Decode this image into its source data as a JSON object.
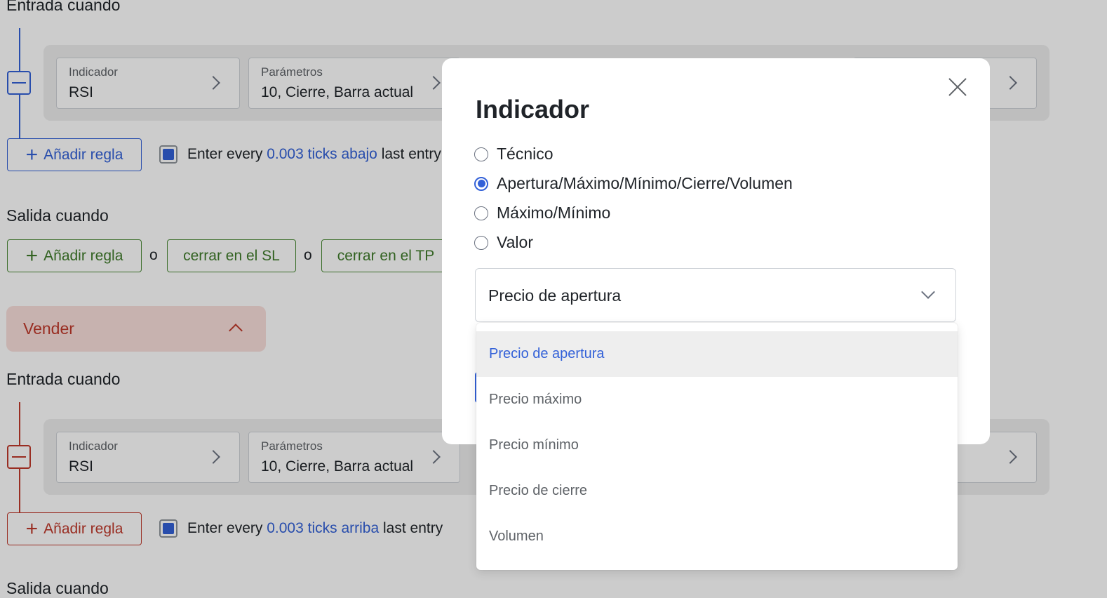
{
  "buy_section": {
    "entry_title": "Entrada cuando",
    "cards": [
      {
        "label": "Indicador",
        "value": "RSI"
      },
      {
        "label": "Parámetros",
        "value": "10, Cierre, Barra actual"
      }
    ],
    "add_rule_label": "Añadir regla",
    "enter": {
      "prefix": "Enter every",
      "link": "0.003 ticks abajo",
      "suffix": "last entry"
    },
    "exit_title": "Salida cuando",
    "exit_add_rule_label": "Añadir regla",
    "or_label": "o",
    "exit_chips": [
      "cerrar en el SL",
      "cerrar en el TP"
    ]
  },
  "sell_panel": {
    "label": "Vender"
  },
  "sell_section": {
    "entry_title": "Entrada cuando",
    "cards": [
      {
        "label": "Indicador",
        "value": "RSI"
      },
      {
        "label": "Parámetros",
        "value": "10, Cierre, Barra actual"
      }
    ],
    "add_rule_label": "Añadir regla",
    "enter": {
      "prefix": "Enter every",
      "link": "0.003 ticks arriba",
      "suffix": "last entry"
    },
    "exit_title": "Salida cuando"
  },
  "modal": {
    "title": "Indicador",
    "radio_options": [
      "Técnico",
      "Apertura/Máximo/Mínimo/Cierre/Volumen",
      "Máximo/Mínimo",
      "Valor"
    ],
    "selected_radio": "Apertura/Máximo/Mínimo/Cierre/Volumen",
    "select": {
      "value": "Precio de apertura",
      "options": [
        "Precio de apertura",
        "Precio máximo",
        "Precio mínimo",
        "Precio de cierre",
        "Volumen"
      ]
    }
  },
  "colors": {
    "accent_blue": "#3361d8",
    "sell_red": "#c0392b",
    "exit_green": "#3f7b2a",
    "sell_panel_bg": "#f9dfdb"
  }
}
